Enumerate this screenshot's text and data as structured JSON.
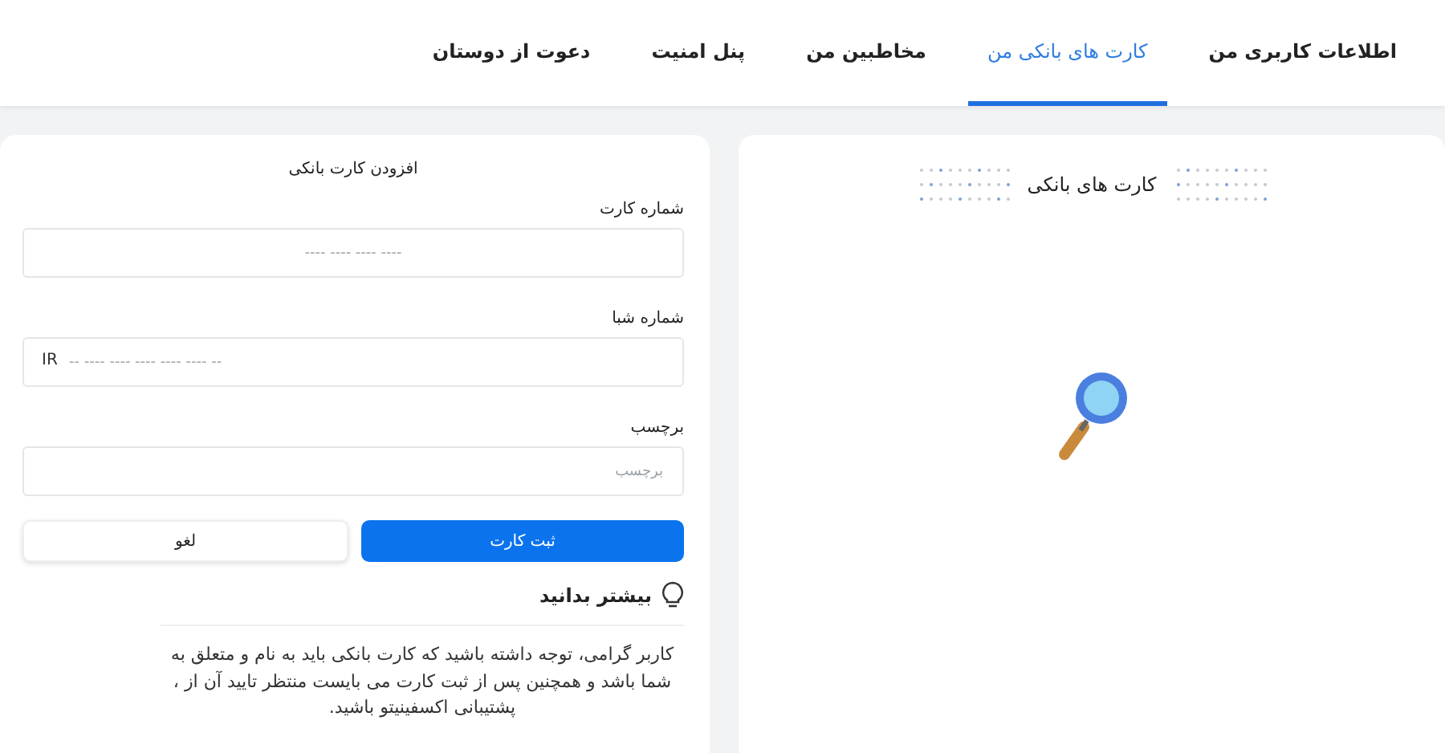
{
  "tabs": [
    {
      "label": "اطلاعات کاربری من",
      "selected": false
    },
    {
      "label": "کارت های بانکی من",
      "selected": true
    },
    {
      "label": "مخاطبین من",
      "selected": false
    },
    {
      "label": "پنل امنیت",
      "selected": false
    },
    {
      "label": "دعوت از دوستان",
      "selected": false
    }
  ],
  "cards_panel": {
    "title": "کارت های بانکی"
  },
  "add_card_form": {
    "title": "افزودن کارت بانکی",
    "fields": [
      {
        "label": "شماره کارت",
        "placeholder": "---- ---- ---- ----"
      },
      {
        "label": "شماره شبا",
        "prefix": "IR",
        "placeholder": "-- ---- ---- ---- ---- ---- --"
      },
      {
        "label": "برچسب",
        "placeholder": "برچسب"
      }
    ],
    "buttons": [
      {
        "label": "ثبت کارت",
        "kind": "primary"
      },
      {
        "label": "لغو",
        "kind": "secondary"
      }
    ],
    "info": {
      "heading": "بیشتر بدانید",
      "text": "کاربر گرامی، توجه داشته باشید که کارت بانکی باید به نام و متعلق به شما باشد و همچنین پس از ثبت کارت می بایست منتظر تایید آن از ، پشتیبانی اکسفینیتو باشید."
    }
  }
}
